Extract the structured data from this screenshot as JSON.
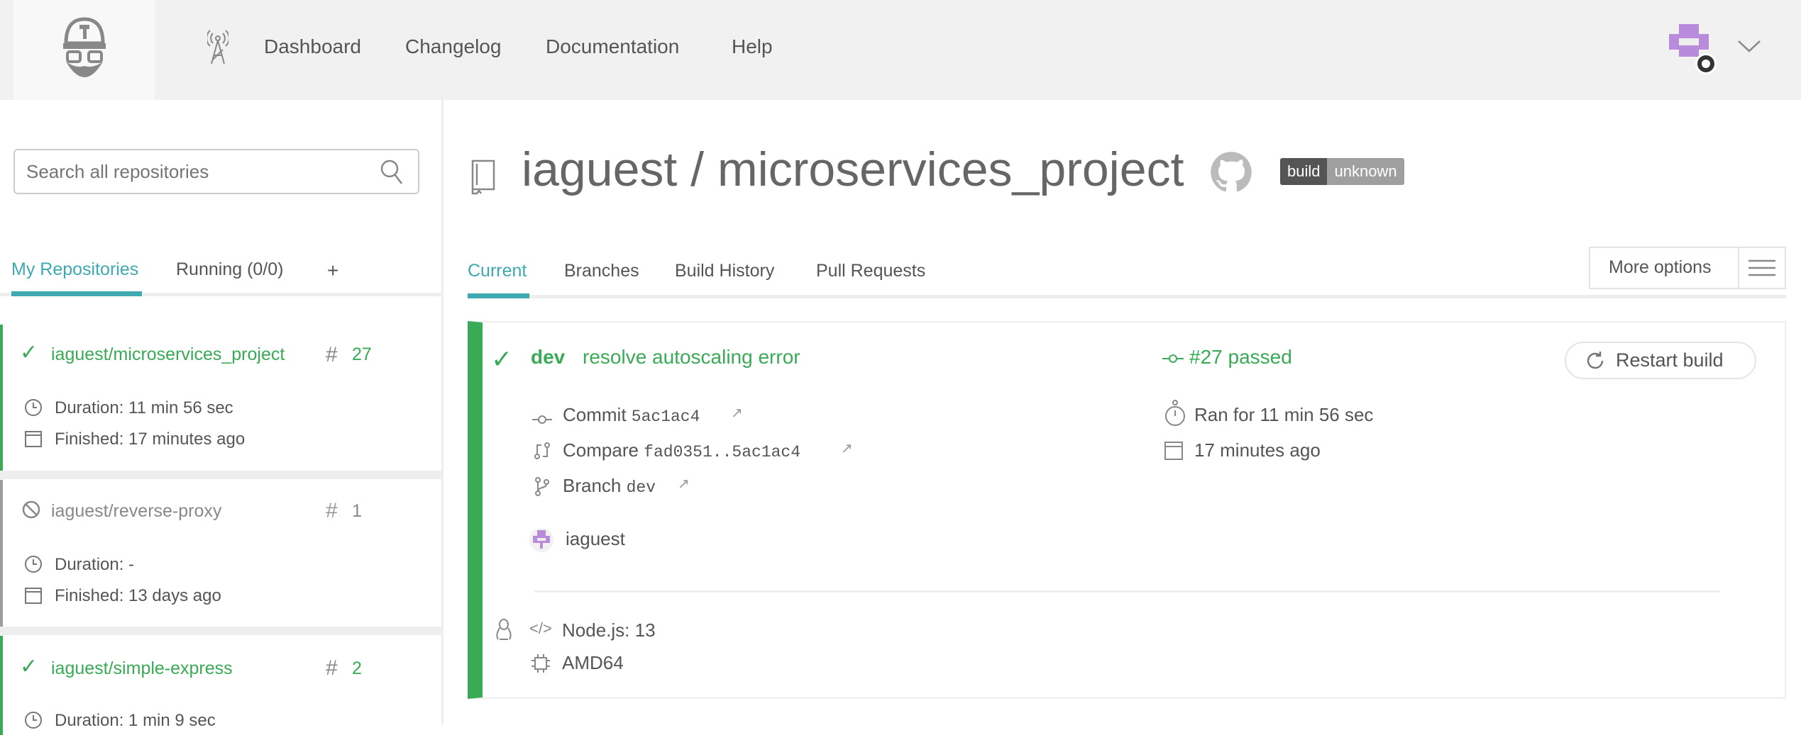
{
  "nav": {
    "items": [
      "Dashboard",
      "Changelog",
      "Documentation",
      "Help"
    ]
  },
  "sidebar": {
    "search_placeholder": "Search all repositories",
    "tabs": [
      "My Repositories",
      "Running (0/0)",
      "+"
    ],
    "repos": [
      {
        "name": "iaguest/microservices_project",
        "status": "passed",
        "number": "27",
        "duration": "Duration: 11 min 56 sec",
        "finished": "Finished: 17 minutes ago"
      },
      {
        "name": "iaguest/reverse-proxy",
        "status": "canceled",
        "number": "1",
        "duration": "Duration: -",
        "finished": "Finished: 13 days ago"
      },
      {
        "name": "iaguest/simple-express",
        "status": "passed",
        "number": "2",
        "duration": "Duration: 1 min 9 sec"
      }
    ]
  },
  "repo": {
    "title": "iaguest / microservices_project",
    "badge_left": "build",
    "badge_right": "unknown"
  },
  "tabs": [
    "Current",
    "Branches",
    "Build History",
    "Pull Requests"
  ],
  "more_options": "More options",
  "build": {
    "branch": "dev",
    "message": "resolve autoscaling error",
    "status": "#27 passed",
    "restart": "Restart build",
    "commit_label": "Commit",
    "commit": "5ac1ac4",
    "compare_label": "Compare",
    "compare": "fad0351..5ac1ac4",
    "branch_label": "Branch",
    "branch_name": "dev",
    "author": "iaguest",
    "ran_for": "Ran for 11 min 56 sec",
    "finished": "17 minutes ago",
    "language": "Node.js: 13",
    "arch": "AMD64"
  },
  "colors": {
    "green": "#39aa56",
    "teal": "#3eaaaf",
    "gray": "#9d9d9d"
  }
}
